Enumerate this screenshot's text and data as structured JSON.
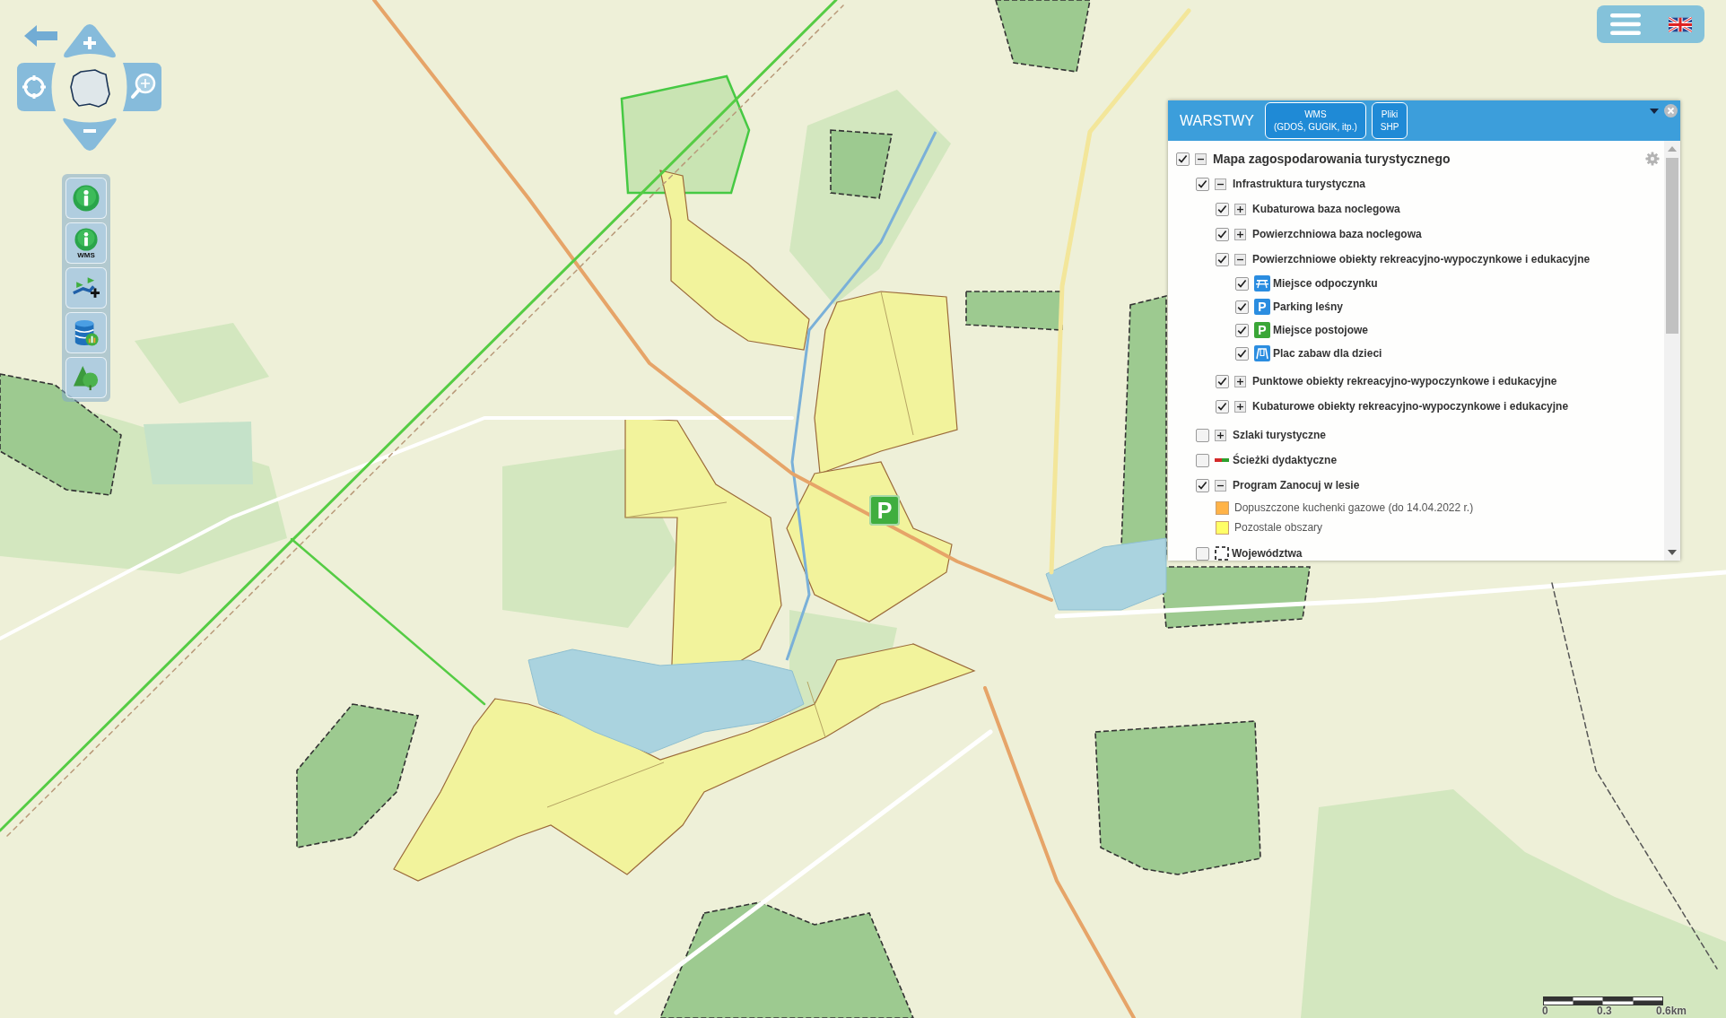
{
  "map": {
    "marker": {
      "symbol": "P",
      "color": "#3fae3f"
    },
    "scale": {
      "labels": [
        "0",
        "0.3",
        "0.6km"
      ]
    }
  },
  "toolbar": [
    {
      "kind": "info"
    },
    {
      "kind": "info",
      "caption": "WMS"
    },
    {
      "kind": "route"
    },
    {
      "kind": "database"
    },
    {
      "kind": "forest"
    }
  ],
  "layers_panel": {
    "title": "WARSTWY",
    "buttons": [
      {
        "label": "WMS\n(GDOŚ, GUGIK, itp.)"
      },
      {
        "label": "Pliki\nSHP"
      }
    ],
    "layers": [
      {
        "label": "Mapa zagospodarowania turystycznego",
        "kind": "group",
        "checked": true,
        "expanded": true,
        "children": [
          {
            "label": "Infrastruktura turystyczna",
            "kind": "group",
            "checked": true,
            "expanded": true,
            "children": [
              {
                "label": "Kubaturowa baza noclegowa",
                "kind": "group",
                "checked": true,
                "expanded": false
              },
              {
                "label": "Powierzchniowa baza noclegowa",
                "kind": "group",
                "checked": true,
                "expanded": false
              },
              {
                "label": "Powierzchniowe obiekty rekreacyjno-wypoczynkowe i edukacyjne",
                "kind": "group",
                "checked": true,
                "expanded": true,
                "children": [
                  {
                    "label": "Miejsce odpoczynku",
                    "kind": "picnic",
                    "checked": true,
                    "color": "#2b8de0"
                  },
                  {
                    "label": "Parking leśny",
                    "kind": "parking",
                    "checked": true,
                    "color": "#2b8de0",
                    "symbol": "P"
                  },
                  {
                    "label": "Miejsce postojowe",
                    "kind": "parking",
                    "checked": true,
                    "color": "#3aa637",
                    "symbol": "P"
                  },
                  {
                    "label": "Plac zabaw dla dzieci",
                    "kind": "playground",
                    "checked": true,
                    "color": "#2b8de0"
                  }
                ]
              },
              {
                "label": "Punktowe obiekty rekreacyjno-wypoczynkowe i edukacyjne",
                "kind": "group",
                "checked": true,
                "expanded": false
              },
              {
                "label": "Kubaturowe obiekty rekreacyjno-wypoczynkowe i edukacyjne",
                "kind": "group",
                "checked": true,
                "expanded": false
              }
            ]
          },
          {
            "label": "Szlaki turystyczne",
            "kind": "group",
            "checked": false,
            "expanded": false
          },
          {
            "label": "Ścieżki dydaktyczne",
            "kind": "trail",
            "checked": false
          },
          {
            "label": "Program Zanocuj w lesie",
            "kind": "group",
            "checked": true,
            "expanded": true,
            "children": [
              {
                "label": "Dopuszczone kuchenki gazowe (do 14.04.2022 r.)",
                "kind": "swatch",
                "color": "#ffb347"
              },
              {
                "label": "Pozostale obszary",
                "kind": "swatch",
                "color": "#ffff66"
              }
            ]
          },
          {
            "label": "Województwa",
            "kind": "border",
            "checked": false
          }
        ]
      }
    ]
  }
}
